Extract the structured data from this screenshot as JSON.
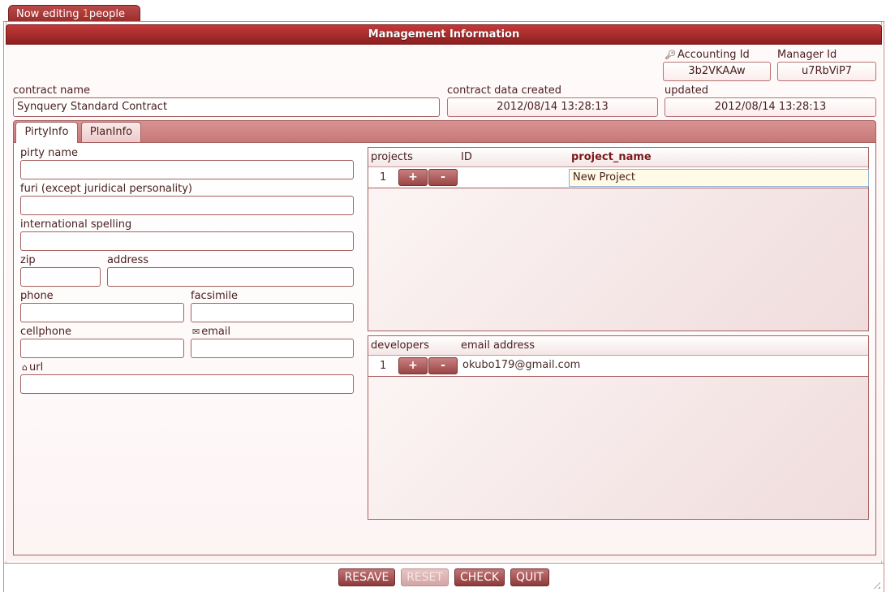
{
  "editing_tab": {
    "prefix": "Now editing ",
    "count": "1",
    "suffix": "people"
  },
  "title": "Management Information",
  "accounting": {
    "label": "Accounting Id",
    "value": "3b2VKAAw"
  },
  "manager": {
    "label": "Manager Id",
    "value": "u7RbViP7"
  },
  "contract_name": {
    "label": "contract name",
    "value": "Synquery Standard Contract"
  },
  "created": {
    "label": "contract data created",
    "value": "2012/08/14 13:28:13"
  },
  "updated": {
    "label": "updated",
    "value": "2012/08/14 13:28:13"
  },
  "tabs": [
    {
      "label": "PirtyInfo",
      "active": true
    },
    {
      "label": "PlanInfo",
      "active": false
    }
  ],
  "form": {
    "pirty_name": {
      "label": "pirty name",
      "value": ""
    },
    "furi": {
      "label": "furi (except juridical personality)",
      "value": ""
    },
    "international": {
      "label": "international spelling",
      "value": ""
    },
    "zip": {
      "label": "zip",
      "value": ""
    },
    "address": {
      "label": "address",
      "value": ""
    },
    "phone": {
      "label": "phone",
      "value": ""
    },
    "facsimile": {
      "label": "facsimile",
      "value": ""
    },
    "cellphone": {
      "label": "cellphone",
      "value": ""
    },
    "email": {
      "label": "email",
      "value": "",
      "icon": "envelope-icon"
    },
    "url": {
      "label": "url",
      "value": "",
      "icon": "home-icon"
    }
  },
  "projects_grid": {
    "headers": [
      "projects",
      "ID",
      "project_name"
    ],
    "rows": [
      {
        "num": "1",
        "add": "+",
        "remove": "-",
        "id": "",
        "name": "New Project"
      }
    ]
  },
  "developers_grid": {
    "headers": [
      "developers",
      "email address"
    ],
    "rows": [
      {
        "num": "1",
        "add": "+",
        "remove": "-",
        "email": "okubo179@gmail.com"
      }
    ]
  },
  "buttons": {
    "resave": "RESAVE",
    "reset": "RESET",
    "check": "CHECK",
    "quit": "QUIT"
  },
  "colors": {
    "accent": "#9e2a2a",
    "border": "#a86060",
    "highlight": "#ff9a60"
  }
}
